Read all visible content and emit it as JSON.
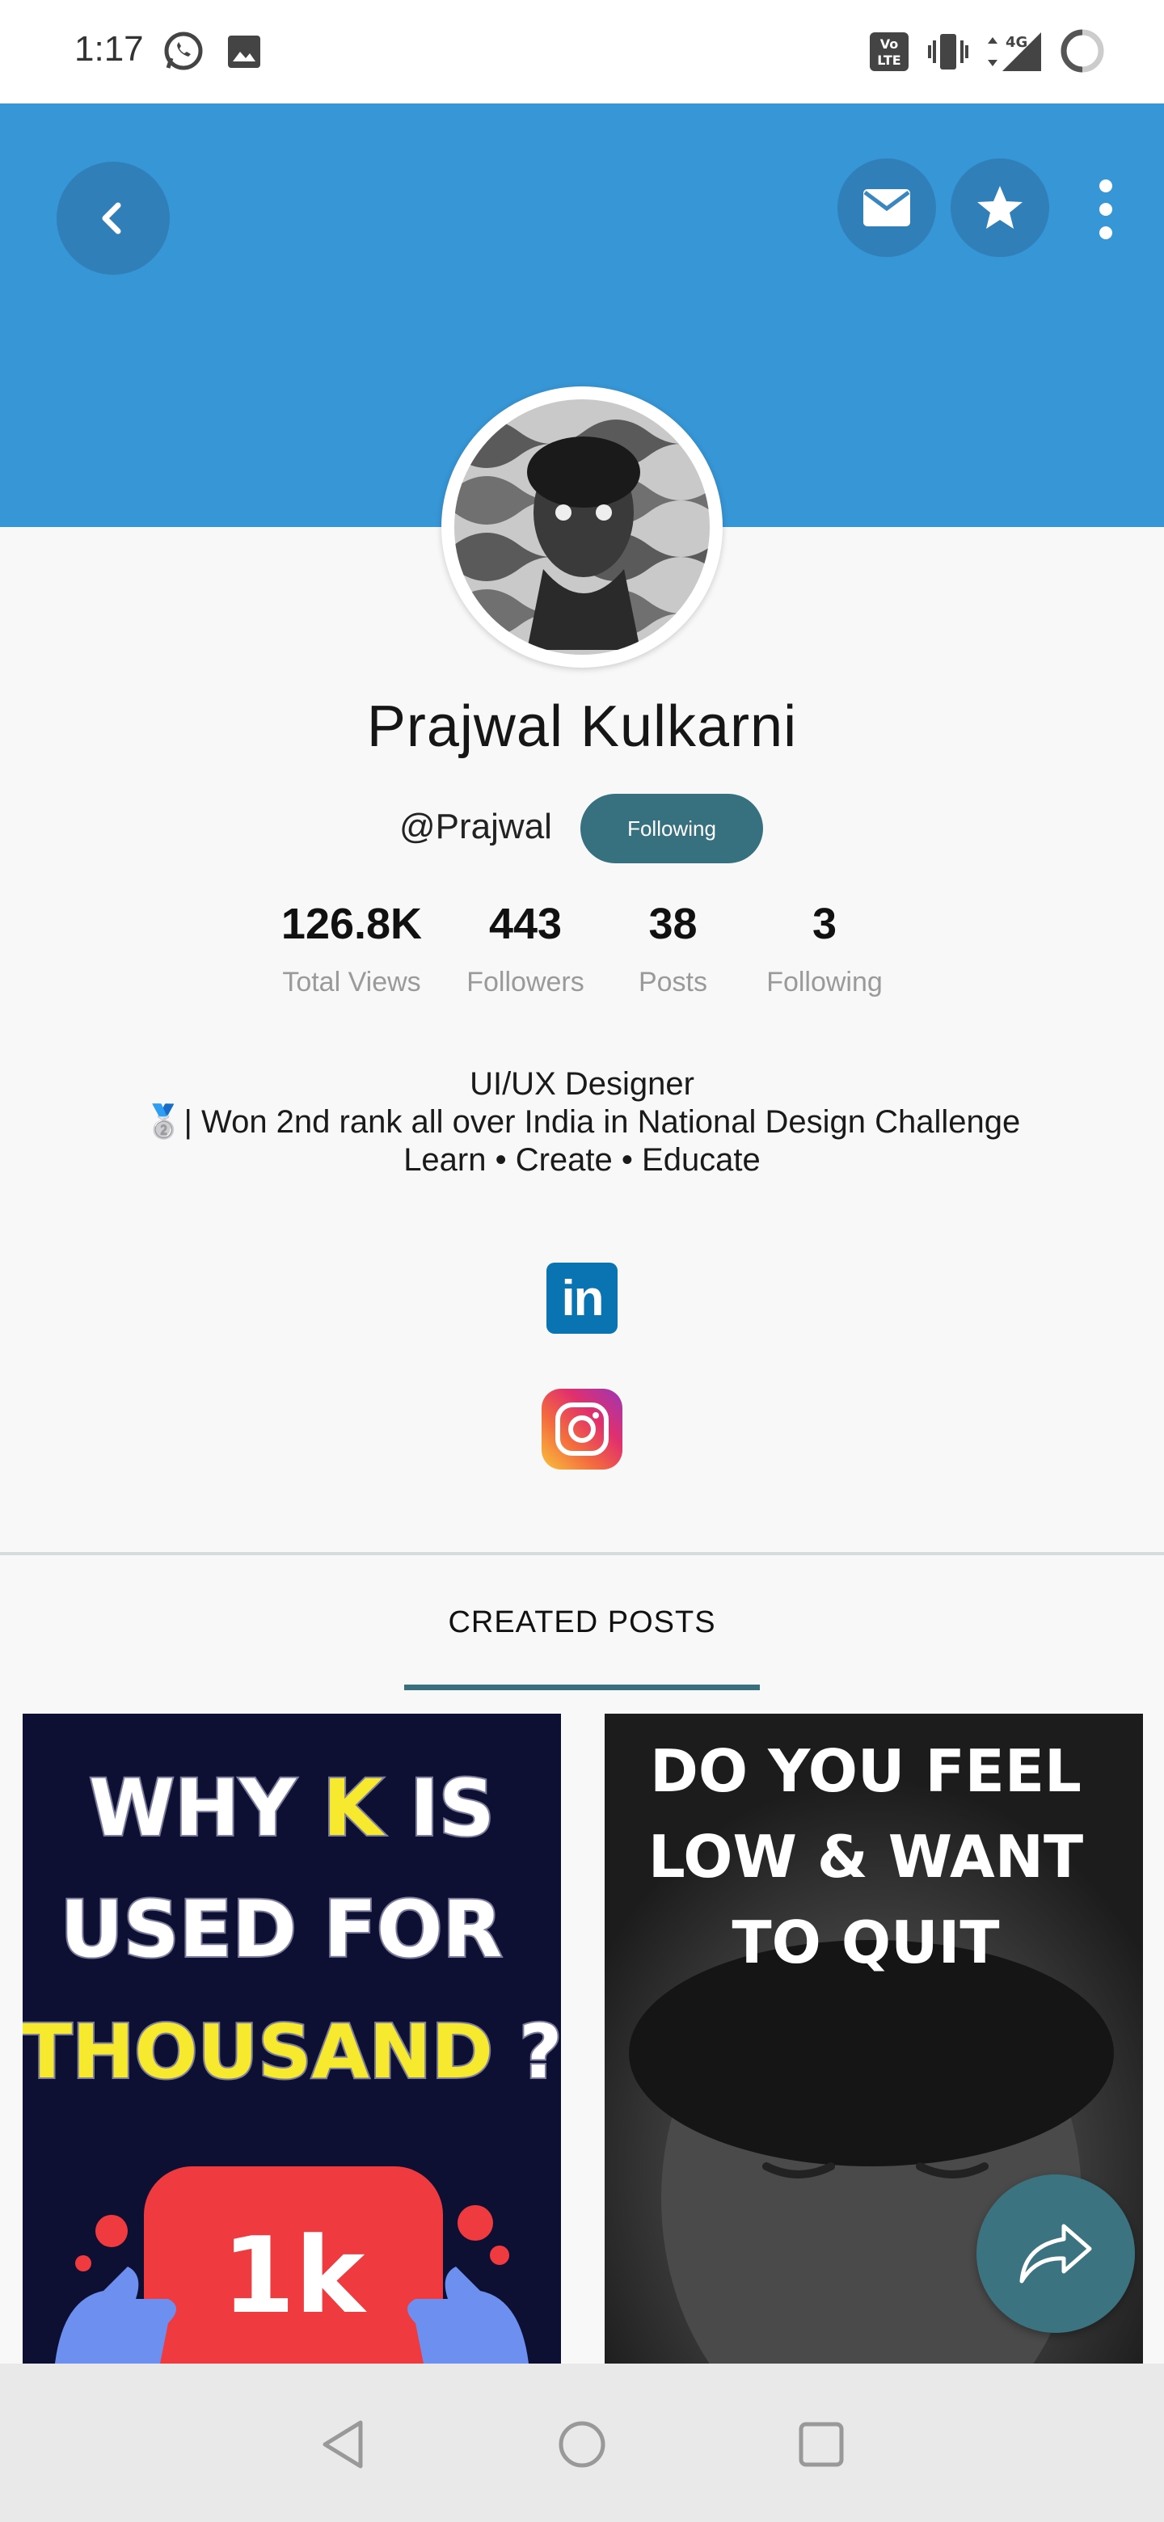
{
  "status_bar": {
    "time": "1:17",
    "icons": [
      "whatsapp-icon",
      "image-icon",
      "volte-icon",
      "vibrate-icon",
      "signal-4g-icon",
      "battery-icon"
    ]
  },
  "header": {
    "background": "#3796d6",
    "back_icon": "chevron-left-icon",
    "mail_icon": "mail-icon",
    "star_icon": "star-icon",
    "more_icon": "more-vertical-icon"
  },
  "profile": {
    "name": "Prajwal Kulkarni",
    "handle": "@Prajwal",
    "follow_label": "Following"
  },
  "stats": [
    {
      "value": "126.8K",
      "label": "Total Views"
    },
    {
      "value": "443",
      "label": "Followers"
    },
    {
      "value": "38",
      "label": "Posts"
    },
    {
      "value": "3",
      "label": "Following"
    }
  ],
  "bio": {
    "line1": "UI/UX Designer",
    "line2": "🥈| Won 2nd rank all over India in National Design Challenge",
    "line3": "Learn • Create • Educate"
  },
  "social": [
    {
      "icon": "linkedin-icon",
      "text": "in"
    },
    {
      "icon": "instagram-icon"
    }
  ],
  "tabs": {
    "created_posts": "CREATED POSTS",
    "accent": "#3a6f7e"
  },
  "posts": [
    {
      "line1_a": "WHY ",
      "line1_b": "K",
      "line1_c": " IS",
      "line2": "USED FOR",
      "line3_a": "THOUSAND",
      "line3_b": " ?",
      "badge": "1k"
    },
    {
      "line1": "DO YOU FEEL",
      "line2": "LOW & WANT",
      "line3": "TO QUIT"
    }
  ],
  "fab_icon": "share-icon",
  "nav": [
    "back-triangle-icon",
    "home-circle-icon",
    "recents-square-icon"
  ]
}
